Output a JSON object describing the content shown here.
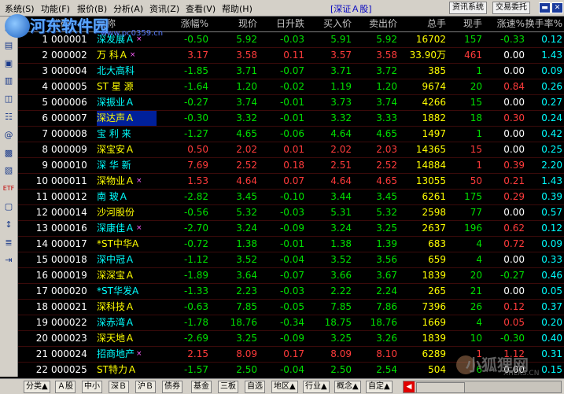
{
  "menu": {
    "items": [
      "系统(S)",
      "功能(F)",
      "报价(B)",
      "分析(A)",
      "资讯(Z)",
      "查看(V)",
      "帮助(H)"
    ],
    "market": "[深证Ａ股]",
    "buttons": [
      "资讯系统",
      "交易委托"
    ]
  },
  "watermark": {
    "text": "河东软件园",
    "url": "www.pc0359.cn"
  },
  "brand_watermark": {
    "text": "小狐狸网",
    "url": "XHLKS.CN"
  },
  "sidebar_icons": [
    "grid-icon",
    "chart-icon",
    "calendar-icon",
    "table-icon",
    "note-icon",
    "money-icon",
    "at-icon",
    "stats-icon",
    "book-icon",
    "etf-icon",
    "box-icon",
    "rank-icon",
    "list-icon",
    "exit-icon"
  ],
  "table": {
    "headers": [
      "",
      "代码",
      "名称",
      "涨幅%",
      "现价",
      "日升跌",
      "买入价",
      "卖出价",
      "总手",
      "现手",
      "涨速%",
      "换手率%"
    ],
    "rows": [
      {
        "n": "1",
        "code": "000001",
        "name": "深发展Ａ",
        "mark": true,
        "chg": "-0.50",
        "price": "5.92",
        "diff": "-0.03",
        "buy": "5.91",
        "sell": "5.92",
        "vol": "16702",
        "now": "157",
        "speed": "-0.33",
        "turn": "0.12"
      },
      {
        "n": "2",
        "code": "000002",
        "name": "万 科Ａ",
        "mark": true,
        "chg": "3.17",
        "price": "3.58",
        "diff": "0.11",
        "buy": "3.57",
        "sell": "3.58",
        "vol": "33.90万",
        "now": "461",
        "speed": "0.00",
        "turn": "1.43"
      },
      {
        "n": "3",
        "code": "000004",
        "name": "北大高科",
        "mark": false,
        "chg": "-1.85",
        "price": "3.71",
        "diff": "-0.07",
        "buy": "3.71",
        "sell": "3.72",
        "vol": "385",
        "now": "1",
        "speed": "0.00",
        "turn": "0.09"
      },
      {
        "n": "4",
        "code": "000005",
        "name": "ST 星 源",
        "mark": false,
        "chg": "-1.64",
        "price": "1.20",
        "diff": "-0.02",
        "buy": "1.19",
        "sell": "1.20",
        "vol": "9674",
        "now": "20",
        "speed": "0.84",
        "turn": "0.26"
      },
      {
        "n": "5",
        "code": "000006",
        "name": "深振业Ａ",
        "mark": false,
        "chg": "-0.27",
        "price": "3.74",
        "diff": "-0.01",
        "buy": "3.73",
        "sell": "3.74",
        "vol": "4266",
        "now": "15",
        "speed": "0.00",
        "turn": "0.27"
      },
      {
        "n": "6",
        "code": "000007",
        "name": "深达声Ａ",
        "mark": false,
        "chg": "-0.30",
        "price": "3.32",
        "diff": "-0.01",
        "buy": "3.32",
        "sell": "3.33",
        "vol": "1882",
        "now": "18",
        "speed": "0.30",
        "turn": "0.24"
      },
      {
        "n": "7",
        "code": "000008",
        "name": "宝 利 来",
        "mark": false,
        "chg": "-1.27",
        "price": "4.65",
        "diff": "-0.06",
        "buy": "4.64",
        "sell": "4.65",
        "vol": "1497",
        "now": "1",
        "speed": "0.00",
        "turn": "0.42"
      },
      {
        "n": "8",
        "code": "000009",
        "name": "深宝安Ａ",
        "mark": false,
        "chg": "0.50",
        "price": "2.02",
        "diff": "0.01",
        "buy": "2.02",
        "sell": "2.03",
        "vol": "14365",
        "now": "15",
        "speed": "0.00",
        "turn": "0.25"
      },
      {
        "n": "9",
        "code": "000010",
        "name": "深 华 新",
        "mark": false,
        "chg": "7.69",
        "price": "2.52",
        "diff": "0.18",
        "buy": "2.51",
        "sell": "2.52",
        "vol": "14884",
        "now": "1",
        "speed": "0.39",
        "turn": "2.20"
      },
      {
        "n": "10",
        "code": "000011",
        "name": "深物业Ａ",
        "mark": true,
        "chg": "1.53",
        "price": "4.64",
        "diff": "0.07",
        "buy": "4.64",
        "sell": "4.65",
        "vol": "13055",
        "now": "50",
        "speed": "0.21",
        "turn": "1.43"
      },
      {
        "n": "11",
        "code": "000012",
        "name": "南 玻Ａ",
        "mark": false,
        "chg": "-2.82",
        "price": "3.45",
        "diff": "-0.10",
        "buy": "3.44",
        "sell": "3.45",
        "vol": "6261",
        "now": "175",
        "speed": "0.29",
        "turn": "0.39"
      },
      {
        "n": "12",
        "code": "000014",
        "name": "沙河股份",
        "mark": false,
        "chg": "-0.56",
        "price": "5.32",
        "diff": "-0.03",
        "buy": "5.31",
        "sell": "5.32",
        "vol": "2598",
        "now": "77",
        "speed": "0.00",
        "turn": "0.57"
      },
      {
        "n": "13",
        "code": "000016",
        "name": "深康佳Ａ",
        "mark": true,
        "chg": "-2.70",
        "price": "3.24",
        "diff": "-0.09",
        "buy": "3.24",
        "sell": "3.25",
        "vol": "2637",
        "now": "196",
        "speed": "0.62",
        "turn": "0.12"
      },
      {
        "n": "14",
        "code": "000017",
        "name": "*ST中华A",
        "mark": false,
        "chg": "-0.72",
        "price": "1.38",
        "diff": "-0.01",
        "buy": "1.38",
        "sell": "1.39",
        "vol": "683",
        "now": "4",
        "speed": "0.72",
        "turn": "0.09"
      },
      {
        "n": "15",
        "code": "000018",
        "name": "深中冠Ａ",
        "mark": false,
        "chg": "-1.12",
        "price": "3.52",
        "diff": "-0.04",
        "buy": "3.52",
        "sell": "3.56",
        "vol": "659",
        "now": "4",
        "speed": "0.00",
        "turn": "0.33"
      },
      {
        "n": "16",
        "code": "000019",
        "name": "深深宝Ａ",
        "mark": false,
        "chg": "-1.89",
        "price": "3.64",
        "diff": "-0.07",
        "buy": "3.66",
        "sell": "3.67",
        "vol": "1839",
        "now": "20",
        "speed": "-0.27",
        "turn": "0.46"
      },
      {
        "n": "17",
        "code": "000020",
        "name": "*ST华发A",
        "mark": false,
        "chg": "-1.33",
        "price": "2.23",
        "diff": "-0.03",
        "buy": "2.22",
        "sell": "2.24",
        "vol": "265",
        "now": "21",
        "speed": "0.00",
        "turn": "0.05"
      },
      {
        "n": "18",
        "code": "000021",
        "name": "深科技Ａ",
        "mark": false,
        "chg": "-0.63",
        "price": "7.85",
        "diff": "-0.05",
        "buy": "7.85",
        "sell": "7.86",
        "vol": "7396",
        "now": "26",
        "speed": "0.12",
        "turn": "0.37"
      },
      {
        "n": "19",
        "code": "000022",
        "name": "深赤湾Ａ",
        "mark": false,
        "chg": "-1.78",
        "price": "18.76",
        "diff": "-0.34",
        "buy": "18.75",
        "sell": "18.76",
        "vol": "1669",
        "now": "4",
        "speed": "0.05",
        "turn": "0.20"
      },
      {
        "n": "20",
        "code": "000023",
        "name": "深天地Ａ",
        "mark": false,
        "chg": "-2.69",
        "price": "3.25",
        "diff": "-0.09",
        "buy": "3.25",
        "sell": "3.26",
        "vol": "1839",
        "now": "10",
        "speed": "-0.30",
        "turn": "0.40"
      },
      {
        "n": "21",
        "code": "000024",
        "name": "招商地产",
        "mark": true,
        "chg": "2.15",
        "price": "8.09",
        "diff": "0.17",
        "buy": "8.09",
        "sell": "8.10",
        "vol": "6289",
        "now": "1",
        "speed": "1.12",
        "turn": "0.31"
      },
      {
        "n": "22",
        "code": "000025",
        "name": "ST特力Ａ",
        "mark": false,
        "chg": "-1.57",
        "price": "2.50",
        "diff": "-0.04",
        "buy": "2.50",
        "sell": "2.54",
        "vol": "504",
        "now": "6",
        "speed": "0.00",
        "turn": "0.15"
      }
    ]
  },
  "bottom_tabs": [
    "分类▲",
    "Ａ股",
    "中小",
    "深Ｂ",
    "沪Ｂ",
    "债券",
    "基金",
    "三板",
    "自选",
    "地区▲",
    "行业▲",
    "概念▲",
    "自定▲"
  ],
  "colors": {
    "up": "#ff3b3b",
    "down": "#00e000",
    "flat": "#ffffff",
    "highlight": "#00209a"
  }
}
